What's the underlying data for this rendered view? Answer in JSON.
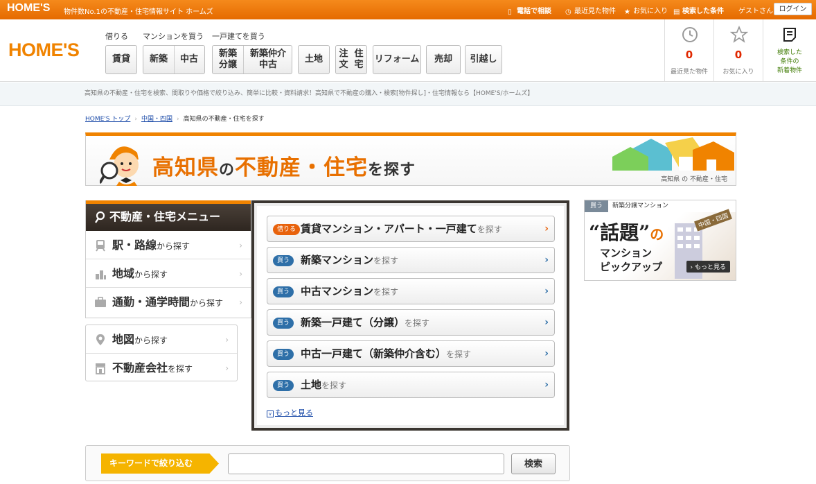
{
  "topbar": {
    "logo": "HOME'S",
    "tagline": "物件数No.1の不動産・住宅情報サイト ホームズ",
    "phone": "電話で相談",
    "recent": "最近見た物件",
    "favorite": "お気に入り",
    "searched": "検索した条件",
    "guest": "ゲストさん",
    "login": "ログイン"
  },
  "header": {
    "logo": "HOME'S",
    "groups": {
      "rent": "借りる",
      "mansion": "マンションを買う",
      "house": "一戸建てを買う"
    },
    "buttons": {
      "chintai": "賃貸",
      "shinchiku": "新築",
      "chuko": "中古",
      "shinchiku_bunjo_1": "新築",
      "shinchiku_bunjo_2": "分譲",
      "shinchiku_chukai_1": "新築仲介",
      "shinchiku_chukai_2": "中古",
      "tochi": "土地",
      "chumon_1": "注文",
      "chumon_2": "住宅",
      "reform": "リフォーム",
      "baikyaku": "売却",
      "hikkoshi": "引越し"
    },
    "recent_count": "0",
    "recent_label": "最近見た物件",
    "favorite_count": "0",
    "favorite_label": "お気に入り",
    "new_label_1": "検索した",
    "new_label_2": "条件の",
    "new_label_3": "新着物件"
  },
  "subheader": "高知県の不動産・住宅を検索、間取りや価格で絞り込み、簡単に比較・資料請求！高知県で不動産の購入・検索[物件探し]・住宅情報なら【HOME'S/ホームズ】",
  "breadcrumb": {
    "top": "HOME'S トップ",
    "region": "中国・四国",
    "current": "高知県の不動産・住宅を探す"
  },
  "banner": {
    "title_1": "高知県",
    "title_2": "の",
    "title_3": "不動産・住宅",
    "title_4": "を探す",
    "caption": "高知県 の 不動産・住宅"
  },
  "side_menu": {
    "title": "不動産・住宅メニュー",
    "items": [
      {
        "main": "駅・路線",
        "sub": "から探す"
      },
      {
        "main": "地域",
        "sub": "から探す"
      },
      {
        "main": "通勤・通学時間",
        "sub": "から探す"
      }
    ],
    "items2": [
      {
        "main": "地図",
        "sub": "から探す"
      },
      {
        "main": "不動産会社",
        "sub": "を探す"
      }
    ]
  },
  "main_menu": {
    "rows": [
      {
        "tag": "借りる",
        "label": "賃貸マンション・アパート・一戸建て",
        "suffix": "を探す"
      },
      {
        "tag": "買う",
        "label": "新築マンション",
        "suffix": "を探す"
      },
      {
        "tag": "買う",
        "label": "中古マンション",
        "suffix": "を探す"
      },
      {
        "tag": "買う",
        "label": "新築一戸建て（分譲）",
        "suffix": "を探す"
      },
      {
        "tag": "買う",
        "label": "中古一戸建て（新築仲介含む）",
        "suffix": "を探す"
      },
      {
        "tag": "買う",
        "label": "土地",
        "suffix": "を探す"
      }
    ],
    "more": "もっと見る"
  },
  "ad": {
    "tag": "買う",
    "top": "新築分譲マンション",
    "big": "“話題”",
    "no": "の",
    "line2": "マンション",
    "line3": "ピックアップ",
    "region": "中国・四国",
    "more": "› もっと見る"
  },
  "keyword": {
    "label": "キーワードで絞り込む",
    "placeholder": "",
    "button": "検索"
  },
  "colors": {
    "brand": "#f08300",
    "link": "#1a4aa8",
    "buy_tag": "#2e6fa8",
    "rent_tag": "#e8620c"
  }
}
